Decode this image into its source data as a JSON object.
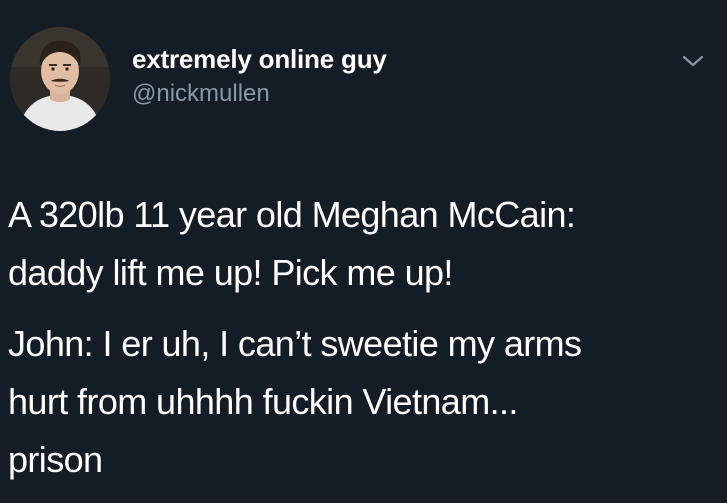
{
  "author": {
    "name": "extremely online guy",
    "handle": "@nickmullen",
    "avatar_icon": "profile-photo"
  },
  "menu": {
    "icon": "chevron-down-icon"
  },
  "tweet": {
    "paragraphs": [
      {
        "lines": [
          "A 320lb 11 year old Meghan McCain:",
          "daddy lift me up! Pick me up!"
        ]
      },
      {
        "lines": [
          "John: I er uh, I can’t sweetie my arms",
          "hurt from uhhhh fuckin Vietnam...",
          "prison"
        ]
      }
    ]
  },
  "colors": {
    "background": "#141d26",
    "name": "#ffffff",
    "handle": "#8899a6",
    "chevron": "#8899a6",
    "text": "#ffffff"
  }
}
